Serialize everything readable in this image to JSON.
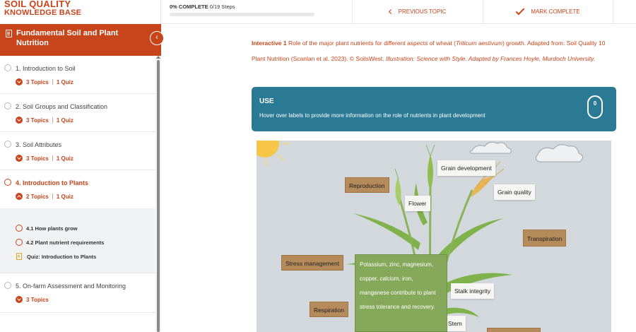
{
  "logo": {
    "line1": "SOIL QUALITY",
    "line2": "KNOWLEDGE BASE"
  },
  "course": {
    "title": "Fundamental Soil and Plant Nutrition"
  },
  "icons": {
    "course_icon": "document-icon",
    "collapse_icon": "chevron-left-icon",
    "prev_icon": "chevron-left-icon",
    "mark_icon": "checkmark-icon",
    "use_icon": "mouse-icon"
  },
  "lessons": [
    {
      "title": "1. Introduction to Soil",
      "topics": "3 Topics",
      "quiz": "1 Quiz"
    },
    {
      "title": "2. Soil Groups and Classification",
      "topics": "3 Topics",
      "quiz": "1 Quiz"
    },
    {
      "title": "3. Soil Attributes",
      "topics": "3 Topics",
      "quiz": "1 Quiz"
    },
    {
      "title": "4. Introduction to Plants",
      "topics": "2 Topics",
      "quiz": "1 Quiz"
    },
    {
      "title": "5. On-farm Assessment and Monitoring",
      "topics": "3 Topics"
    }
  ],
  "active_lesson_topics": [
    {
      "label": "4.1 How plants grow",
      "kind": "topic"
    },
    {
      "label": "4.2 Plant nutrient requirements",
      "kind": "topic"
    },
    {
      "label": "Quiz: Introduction to Plants",
      "kind": "quiz"
    }
  ],
  "progress": {
    "percent_label": "0% COMPLETE",
    "steps_label": "0/19 Steps",
    "fraction": 0
  },
  "nav": {
    "prev_label": "PREVIOUS TOPIC",
    "mark_label": "MARK COMPLETE"
  },
  "caption": {
    "label": "Interactive 1",
    "text_a": " Role of the major plant nutrients for different aspects of wheat (",
    "species": "Triticum aestivum",
    "text_b": ") growth. Adapted from: Soil Quality 10 Plant Nutrition (Scanlan et al. 2023). © SoilsWest. ",
    "italic": "Illustration: Science with Style. Adapted by Frances Hoyle, Murdoch University."
  },
  "use_box": {
    "heading": "USE",
    "text": "Hover over labels to provide more information on the role of nutrients in plant development",
    "icon_text": "0"
  },
  "illustration": {
    "labels": {
      "grain_development": "Grain development",
      "reproduction": "Reproduction",
      "flower": "Flower",
      "grain_quality": "Grain quality",
      "transpiration": "Transpiration",
      "stress_management": "Stress management",
      "stalk_integrity": "Stalk integrity",
      "respiration": "Respiration",
      "stem": "Stem"
    },
    "tooltip": "Potassium, zinc, magnesium, copper, calcium, iron, manganese contribute to plant stress tolerance and recovery."
  },
  "colors": {
    "accent": "#c8441b",
    "use_box": "#2b7a95",
    "tag_brown": "#b58b5b",
    "tooltip_green": "#86a85a"
  }
}
